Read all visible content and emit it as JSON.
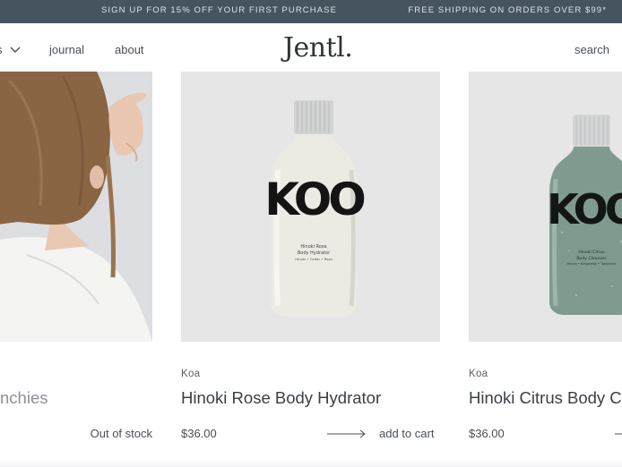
{
  "announcement": {
    "left": "SIGN UP FOR 15% OFF YOUR FIRST PURCHASE",
    "right": "FREE SHIPPING ON ORDERS OVER $99*"
  },
  "header": {
    "nav_shop": "s",
    "nav_journal": "journal",
    "nav_about": "about",
    "logo": "Jentl.",
    "search": "search"
  },
  "products": [
    {
      "title_fragment": "nchies",
      "stock": "Out of stock"
    },
    {
      "brand": "Koa",
      "title": "Hinoki Rose Body Hydrator",
      "price": "$36.00",
      "cta": "add to cart",
      "label_lines": [
        "Hinoki Rose",
        "Body Hydrator",
        "Hinoki • Cedar • Rose"
      ]
    },
    {
      "brand": "Koa",
      "title": "Hinoki Citrus Body Cle",
      "price": "$36.00",
      "label_lines": [
        "Hinoki Citrus",
        "Body Cleanser",
        "Hinoki • Bergamot • Tangerine"
      ]
    }
  ],
  "bottle_wordmark": "KOO",
  "colors": {
    "announcement_bg": "#46545f",
    "hydrator_bottle": "#ecebe3",
    "cleanser_bottle": "#7f9b90"
  }
}
